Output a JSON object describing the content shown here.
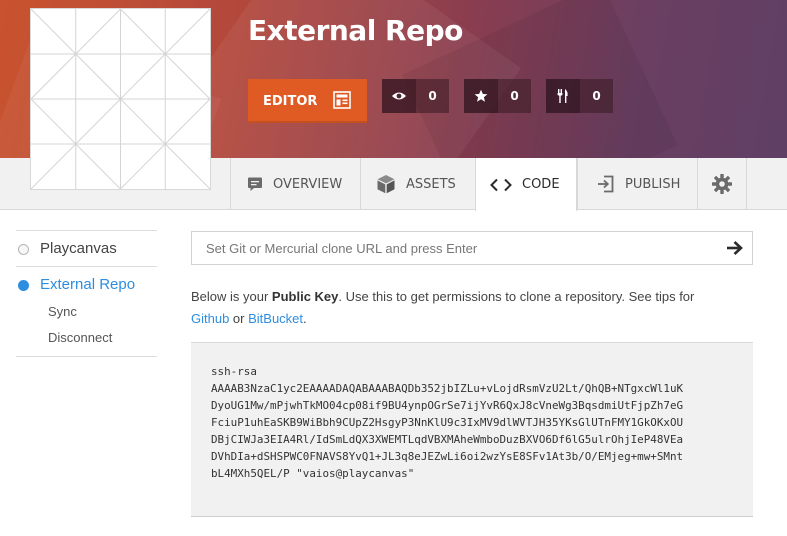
{
  "project": {
    "title": "External Repo"
  },
  "header": {
    "editor_label": "EDITOR",
    "stats": [
      {
        "icon": "eye-icon",
        "value": "0"
      },
      {
        "icon": "star-icon",
        "value": "0"
      },
      {
        "icon": "fork-icon",
        "value": "0"
      }
    ]
  },
  "tabs": [
    {
      "label": "OVERVIEW",
      "icon": "speech-bubble-icon"
    },
    {
      "label": "ASSETS",
      "icon": "cube-icon"
    },
    {
      "label": "CODE",
      "icon": "code-brackets-icon",
      "active": true
    },
    {
      "label": "PUBLISH",
      "icon": "publish-icon"
    },
    {
      "label": "",
      "icon": "gear-icon"
    }
  ],
  "sidebar": {
    "items": [
      {
        "label": "Playcanvas",
        "selected": false
      },
      {
        "label": "External Repo",
        "selected": true
      }
    ],
    "subitems": [
      "Sync",
      "Disconnect"
    ]
  },
  "repo": {
    "placeholder": "Set Git or Mercurial clone URL and press Enter",
    "info_prefix": "Below is your ",
    "info_bold": "Public Key",
    "info_mid": ". Use this to get permissions to clone a repository. See tips for",
    "link_github": "Github",
    "info_or": " or ",
    "link_bitbucket": "BitBucket",
    "info_end": ".",
    "key_lines": [
      "ssh-rsa",
      "AAAAB3NzaC1yc2EAAAADAQABAAABAQDb352jbIZLu+vLojdRsmVzU2Lt/QhQB+NTgxcWl1uK",
      "DyoUG1Mw/mPjwhTkMO04cp08if9BU4ynpOGrSe7ijYvR6QxJ8cVneWg3BqsdmiUtFjpZh7eG",
      "FciuP1uhEaSKB9WiBbh9CUpZ2HsgyP3NnKlU9c3IxMV9dlWVTJH35YKsGlUTnFMY1GkOKxOU",
      "DBjCIWJa3EIA4Rl/IdSmLdQX3XWEMTLqdVBXMAheWmboDuzBXVO6Df6lG5ulrOhjIeP48VEa",
      "DVhDIa+dSHSPWC0FNAVS8YvQ1+JL3q8eJEZwLi6oi2wzYsE8SFv1At3b/O/EMjeg+mw+SMnt",
      "bL4MXh5QEL/P \"vaios@playcanvas\""
    ]
  },
  "colors": {
    "accent_blue": "#2d8ee0",
    "editor_orange": "#e05a24"
  }
}
